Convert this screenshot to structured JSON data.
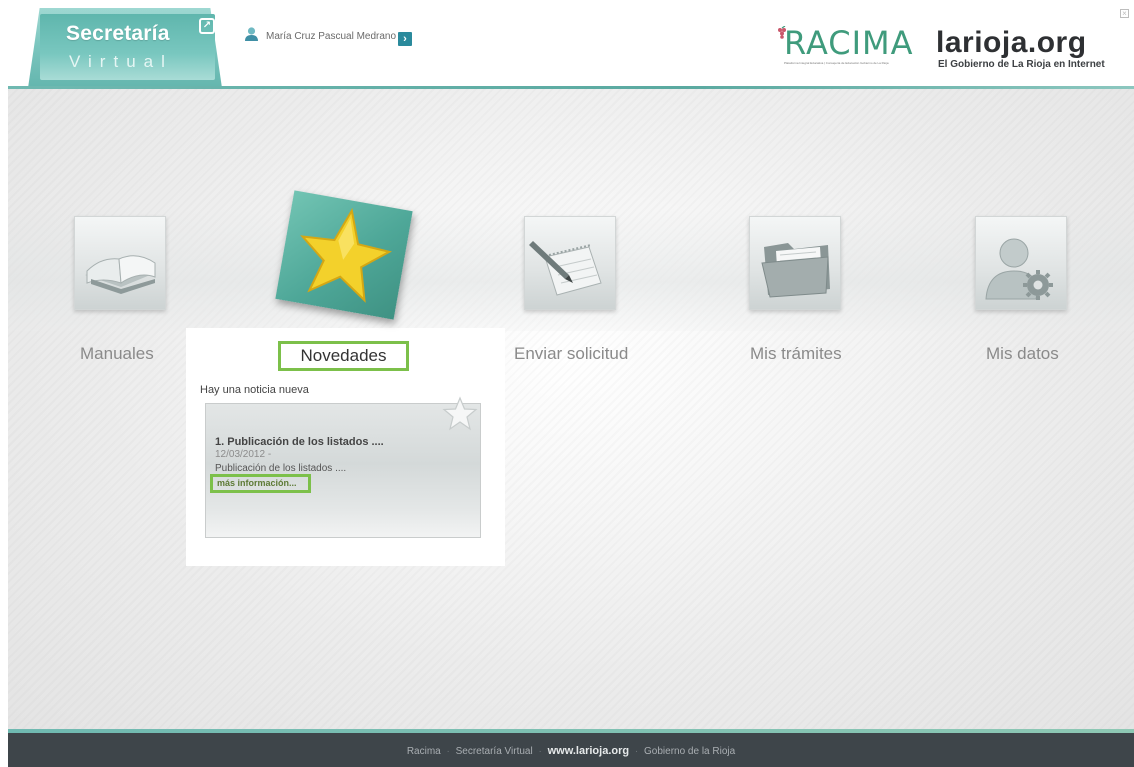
{
  "header": {
    "brand_title": "Secretaría",
    "brand_subtitle": "Virtual",
    "user_name": "María Cruz Pascual Medrano",
    "racima_logo_text": "RACIMA",
    "racima_tagline": "Plataforma Integral Educativa | Consejería de Educación Gobierno de La Rioja",
    "larioja_logo_text": "larioja.org",
    "larioja_tagline": "El Gobierno de La Rioja en Internet"
  },
  "menu": {
    "manuales": "Manuales",
    "novedades": "Novedades",
    "enviar_solicitud": "Enviar solicitud",
    "mis_tramites": "Mis trámites",
    "mis_datos": "Mis datos"
  },
  "news": {
    "intro": "Hay una noticia nueva",
    "items": [
      {
        "title": "1. Publicación de los listados ....",
        "date": "12/03/2012 -",
        "summary": "Publicación de los listados ....",
        "more_link": "más información..."
      }
    ]
  },
  "footer": {
    "link1": "Racima",
    "link2": "Secretaría Virtual",
    "link3": "www.larioja.org",
    "link4": "Gobierno de la Rioja"
  },
  "colors": {
    "accent_teal": "#5fb6ad",
    "highlight_green": "#7cc04a",
    "footer_bg": "#3e454a"
  }
}
